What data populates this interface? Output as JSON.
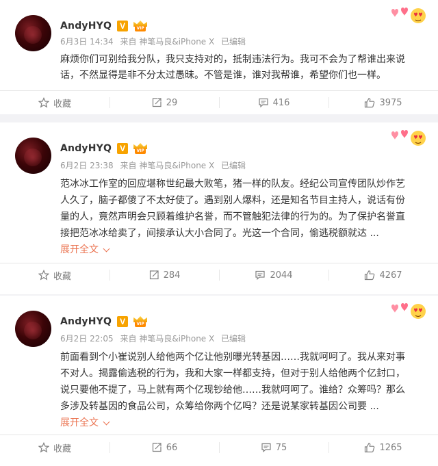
{
  "posts": [
    {
      "username": "AndyHYQ",
      "verified_badge": "V",
      "member_badge": "VIP",
      "date": "6月3日 14:34",
      "source": "来自 神笔马良&iPhone X",
      "edited": "已编辑",
      "lines": [
        "麻烦你们可别给我分队，我只支持对的，抵制违法行为。我可不会为了帮谁出来说",
        "话，不然显得是非不分太过愚昧。不管是谁，谁对我帮谁，希望你们也一样。"
      ],
      "expand_label": "",
      "actions": {
        "favorite": "收藏",
        "repost": "29",
        "comment": "416",
        "like": "3975"
      }
    },
    {
      "username": "AndyHYQ",
      "verified_badge": "V",
      "member_badge": "VIP",
      "date": "6月2日 23:38",
      "source": "来自 神笔马良&iPhone X",
      "edited": "已编辑",
      "lines": [
        "范冰冰工作室的回应堪称世纪最大败笔，猪一样的队友。经纪公司宣传团队炒作艺",
        "人久了，脑子都傻了不太好使了。遇到别人爆料，还是知名节目主持人，说话有份",
        "量的人，竟然声明会只顾着维护名誉，而不管触犯法律的行为的。为了保护名誉直",
        "接把范冰冰给卖了，间接承认大小合同了。光这一个合同，偷逃税额就达 ..."
      ],
      "expand_label": "展开全文",
      "actions": {
        "favorite": "收藏",
        "repost": "284",
        "comment": "2044",
        "like": "4267"
      }
    },
    {
      "username": "AndyHYQ",
      "verified_badge": "V",
      "member_badge": "VIP",
      "date": "6月2日 22:05",
      "source": "来自 神笔马良&iPhone X",
      "edited": "已编辑",
      "lines": [
        "前面看到个小崔说别人给他两个亿让他别曝光转基因……我就呵呵了。我从来对事",
        "不对人。揭露偷逃税的行为，我和大家一样都支持，但对于别人给他两个亿封口，",
        "说只要他不提了，马上就有两个亿现钞给他……我就呵呵了。谁给？众筹吗？那么",
        "多涉及转基因的食品公司，众筹给你两个亿吗？还是说某家转基因公司要 ..."
      ],
      "expand_label": "展开全文",
      "actions": {
        "favorite": "收藏",
        "repost": "66",
        "comment": "75",
        "like": "1265"
      }
    }
  ],
  "colors": {
    "accent": "#eb7350",
    "badge": "#f7a300",
    "meta": "#999999"
  },
  "icons": [
    "star-icon",
    "repost-icon",
    "comment-icon",
    "like-icon",
    "heart-eyes-sticker"
  ]
}
